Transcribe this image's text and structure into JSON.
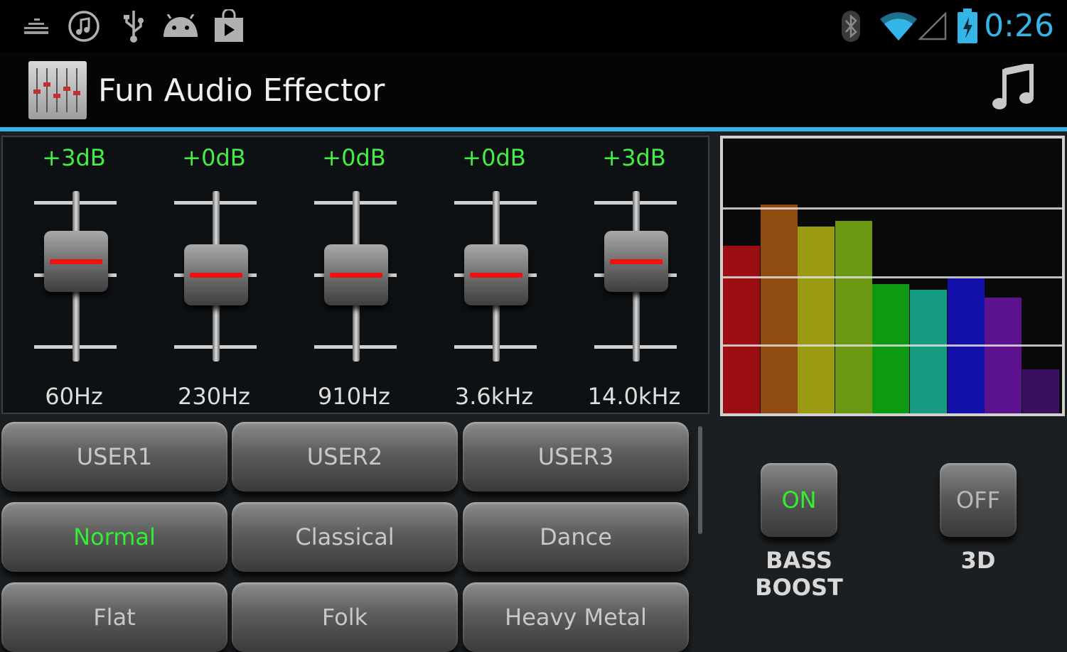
{
  "status_bar": {
    "clock": "0:26",
    "icons": [
      "equalizer-icon",
      "music-icon",
      "usb-icon",
      "android-icon",
      "play-store-icon",
      "bluetooth-icon",
      "wifi-icon",
      "signal-icon",
      "battery-charging-icon"
    ]
  },
  "action_bar": {
    "title": "Fun Audio Effector",
    "icons": [
      "app-equalizer-icon",
      "music-note-icon"
    ]
  },
  "equalizer": {
    "bands": [
      {
        "value": "+3dB",
        "freq": "60Hz",
        "level_db": 3
      },
      {
        "value": "+0dB",
        "freq": "230Hz",
        "level_db": 0
      },
      {
        "value": "+0dB",
        "freq": "910Hz",
        "level_db": 0
      },
      {
        "value": "+0dB",
        "freq": "3.6kHz",
        "level_db": 0
      },
      {
        "value": "+3dB",
        "freq": "14.0kHz",
        "level_db": 3
      }
    ]
  },
  "visualizer": {
    "levels": [
      0.61,
      0.76,
      0.68,
      0.7,
      0.47,
      0.45,
      0.49,
      0.42,
      0.16
    ],
    "colors": [
      "#9b0f12",
      "#8f4c10",
      "#9c9a12",
      "#6b9711",
      "#0d9a12",
      "#179c82",
      "#1210a8",
      "#5c128e",
      "#3a0f5e"
    ]
  },
  "presets": {
    "active": "Normal",
    "items": [
      "USER1",
      "USER2",
      "USER3",
      "Normal",
      "Classical",
      "Dance",
      "Flat",
      "Folk",
      "Heavy Metal"
    ]
  },
  "toggles": {
    "bass_boost": {
      "state": "ON",
      "caption_line1": "BASS",
      "caption_line2": "BOOST",
      "color": "#33ee33"
    },
    "three_d": {
      "state": "OFF",
      "caption": "3D",
      "color": "#b8b8b8"
    }
  },
  "colors": {
    "accent": "#33b5e5",
    "value_green": "#44ee44",
    "knob_line": "#ee1111"
  }
}
